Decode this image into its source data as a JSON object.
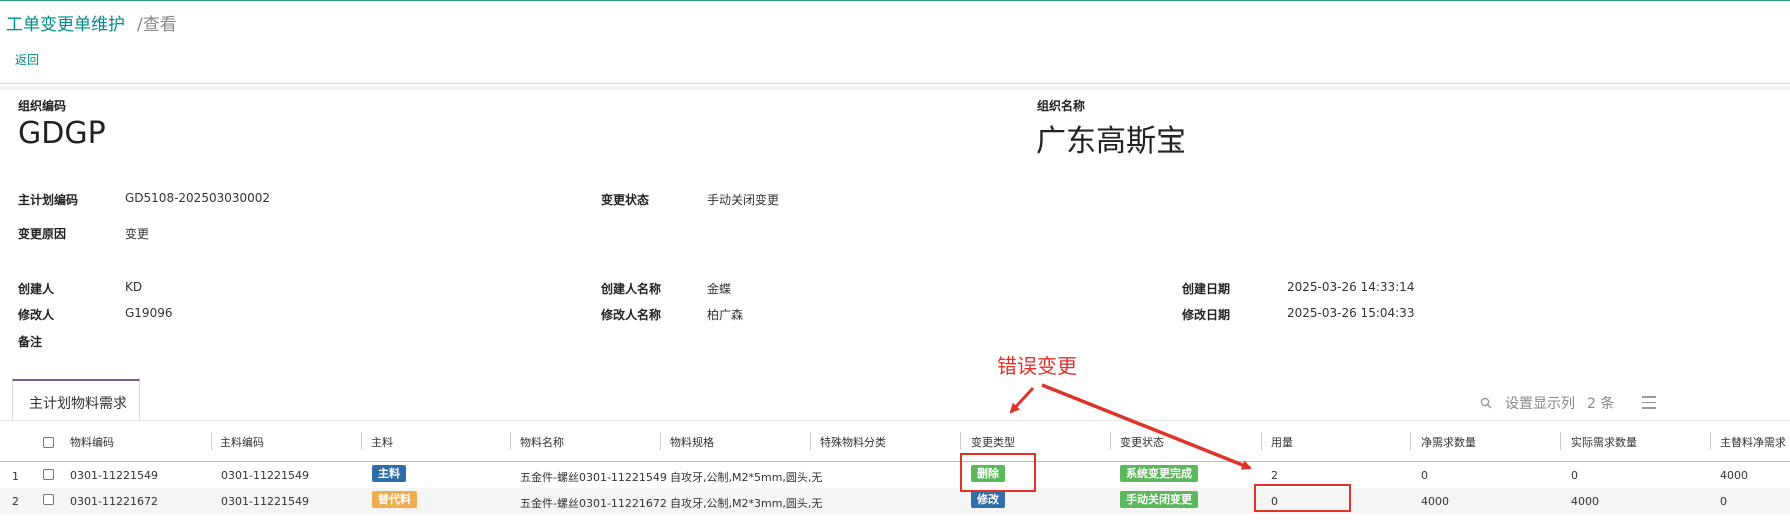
{
  "header": {
    "title": "工单变更单维护",
    "subtitle": "/查看",
    "back_label": "返回"
  },
  "org": {
    "code_label": "组织编码",
    "code_value": "GDGP",
    "name_label": "组织名称",
    "name_value": "广东高斯宝"
  },
  "fields": {
    "plan_code_label": "主计划编码",
    "plan_code_value": "GD5108-202503030002",
    "change_status_label": "变更状态",
    "change_status_value": "手动关闭变更",
    "reason_label": "变更原因",
    "reason_value": "变更",
    "creator_label": "创建人",
    "creator_value": "KD",
    "creator_name_label": "创建人名称",
    "creator_name_value": "金蝶",
    "created_date_label": "创建日期",
    "created_date_value": "2025-03-26 14:33:14",
    "modifier_label": "修改人",
    "modifier_value": "G19096",
    "modifier_name_label": "修改人名称",
    "modifier_name_value": "柏广森",
    "modified_date_label": "修改日期",
    "modified_date_value": "2025-03-26 15:04:33",
    "remark_label": "备注"
  },
  "tab": {
    "label": "主计划物料需求"
  },
  "toolbar": {
    "columns_label": "设置显示列",
    "count_label": "2 条"
  },
  "table": {
    "columns": [
      "物料编码",
      "主料编码",
      "主料",
      "物料名称",
      "物料规格",
      "特殊物料分类",
      "变更类型",
      "变更状态",
      "用量",
      "净需求数量",
      "实际需求数量",
      "主替料净需求"
    ],
    "rows": [
      {
        "index": "1",
        "material_code": "0301-11221549",
        "main_code": "0301-11221549",
        "main_flag": "主料",
        "name": "五金件-螺丝0301-11221549",
        "spec": "自攻牙,公制,M2*5mm,圆头,无",
        "special": "",
        "change_type": "删除",
        "change_status": "系统变更完成",
        "usage": "2",
        "net_demand": "0",
        "actual_demand": "0",
        "main_sub_net": "4000"
      },
      {
        "index": "2",
        "material_code": "0301-11221672",
        "main_code": "0301-11221549",
        "main_flag": "替代料",
        "name": "五金件-螺丝0301-11221672",
        "spec": "自攻牙,公制,M2*3mm,圆头,无",
        "special": "",
        "change_type": "修改",
        "change_status": "手动关闭变更",
        "usage": "0",
        "net_demand": "4000",
        "actual_demand": "4000",
        "main_sub_net": "0"
      }
    ]
  },
  "annotation": {
    "text": "错误变更",
    "color": "#e0322b"
  },
  "colors": {
    "accent": "#008b8b",
    "badge_blue": "#2f6ea7",
    "badge_orange": "#f0ad4e",
    "badge_green": "#5cb85c",
    "tab_top": "#7b5c93"
  }
}
